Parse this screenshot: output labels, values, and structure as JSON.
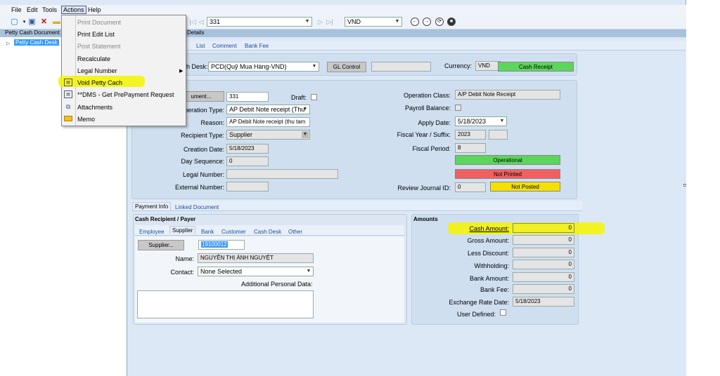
{
  "menubar": {
    "file": "File",
    "edit": "Edit",
    "tools": "Tools",
    "actions": "Actions",
    "help": "Help"
  },
  "toolbar": {
    "record_number": "331",
    "currency": "VND"
  },
  "tabstrip": {
    "left_label": "Petty Cash Document",
    "details_label": "Details"
  },
  "tree": {
    "item": "Petty Cash Desk"
  },
  "actions_menu": {
    "items": [
      {
        "label": "Print Document",
        "enabled": false
      },
      {
        "label": "Print Edit List",
        "enabled": true
      },
      {
        "label": "Post Statement",
        "enabled": false
      },
      {
        "label": "Recalculate",
        "enabled": true
      },
      {
        "label": "Legal Number",
        "enabled": true,
        "submenu": true
      },
      {
        "label": "Void Petty Cach",
        "enabled": true
      },
      {
        "label": "**DMS - Get PrePayment Request",
        "enabled": true
      },
      {
        "label": "Attachments",
        "enabled": true
      },
      {
        "label": "Memo",
        "enabled": true
      }
    ]
  },
  "detail_tabs": [
    "t",
    "List",
    "Comment",
    "Bank Fee"
  ],
  "header": {
    "cash_desk_label": "h Desk:",
    "cash_desk_value": "PCD(Quỹ Mua Hàng-VND)",
    "gl_control": "GL Control",
    "currency_label": "Currency:",
    "currency_value": "VND",
    "cash_receipt": "Cash Receipt"
  },
  "document": {
    "document_button": "ument...",
    "document_number": "331",
    "draft_label": "Draft:",
    "operation_type_label": "peration Type:",
    "operation_type_value": "AP Debit Note receipt (Thu",
    "reason_label": "Reason:",
    "reason_value": "AP Debit Note receipt (thu tam",
    "recipient_type_label": "Recipient Type:",
    "recipient_type_value": "Supplier",
    "creation_date_label": "Creation Date:",
    "creation_date_value": "5/18/2023",
    "day_sequence_label": "Day Sequence:",
    "day_sequence_value": "0",
    "legal_number_label": "Legal Number:",
    "legal_number_value": "",
    "external_number_label": "External Number:",
    "external_number_value": "",
    "operation_class_label": "Operation Class:",
    "operation_class_value": "A/P Debit Note Receipt",
    "payroll_balance_label": "Payroll Balance:",
    "apply_date_label": "Apply Date:",
    "apply_date_value": "5/18/2023",
    "fiscal_year_label": "Fiscal Year / Suffix:",
    "fiscal_year_value": "2023",
    "fiscal_suffix_value": "",
    "fiscal_period_label": "Fiscal Period:",
    "fiscal_period_value": "8",
    "status_operational": "Operational",
    "status_printed": "Not Printed",
    "review_journal_label": "Review Journal ID:",
    "review_journal_value": "0",
    "status_posted": "Not Posted"
  },
  "lower_tabs": [
    "Payment Info",
    "Linked Document"
  ],
  "recipient": {
    "title": "Cash Recipient / Payer",
    "tabs": [
      "Employee",
      "Supplier",
      "Bank",
      "Customer",
      "Cash Desk",
      "Other"
    ],
    "supplier_button": "Supplier...",
    "supplier_id": "19100012",
    "name_label": "Name:",
    "name_value": "NGUYỄN THỊ ÁNH NGUYỆT",
    "contact_label": "Contact:",
    "contact_value": "None Selected",
    "additional_label": "Additional Personal Data:"
  },
  "amounts": {
    "title": "Amounts",
    "cash_amount_label": "Cash Amount:",
    "cash_amount": "0",
    "gross_amount_label": "Gross Amount:",
    "gross_amount": "0",
    "less_discount_label": "Less Discount:",
    "less_discount": "0",
    "withholding_label": "Withholding:",
    "withholding": "0",
    "bank_amount_label": "Bank Amount:",
    "bank_amount": "0",
    "bank_fee_label": "Bank Fee:",
    "bank_fee": "0",
    "exchange_rate_date_label": "Exchange Rate Date:",
    "exchange_rate_date": "5/18/2023",
    "user_defined_label": "User Defined:"
  },
  "colors": {
    "green": "#5bd65b",
    "red": "#f06060",
    "yellow": "#f5e000",
    "highlight": "#f5f500"
  }
}
